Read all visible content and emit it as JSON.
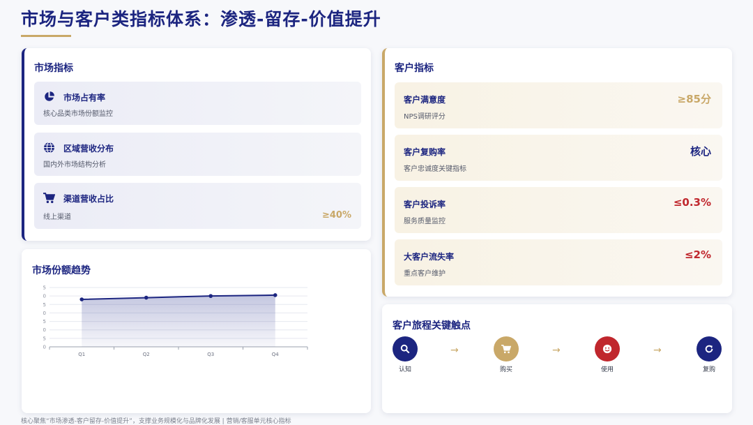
{
  "title": "市场与客户类指标体系：渗透-留存-价值提升",
  "colors": {
    "navy": "#1c2580",
    "gold": "#c9a868",
    "red": "#c0272d"
  },
  "market": {
    "heading": "市场指标",
    "items": [
      {
        "name": "市场占有率",
        "desc": "核心品类市场份额监控",
        "value": "",
        "icon": "pie-chart-icon"
      },
      {
        "name": "区域营收分布",
        "desc": "国内外市场结构分析",
        "value": "",
        "icon": "globe-icon"
      },
      {
        "name": "渠道营收占比",
        "desc": "线上渠道",
        "value": "≥40%",
        "icon": "cart-icon"
      }
    ]
  },
  "trend": {
    "heading": "市场份额趋势",
    "chart_data": {
      "type": "area",
      "categories": [
        "Q1",
        "Q2",
        "Q3",
        "Q4"
      ],
      "values": [
        28,
        29,
        30,
        30.5
      ],
      "ylim": [
        0,
        35
      ],
      "yticks": [
        "0",
        "5",
        "10",
        "15",
        "20",
        "25",
        "30",
        "35"
      ],
      "grid": true,
      "title": "",
      "xlabel": "",
      "ylabel": ""
    }
  },
  "customer": {
    "heading": "客户指标",
    "items": [
      {
        "name": "客户满意度",
        "desc": "NPS调研评分",
        "value": "≥85分",
        "color": "#c9a868"
      },
      {
        "name": "客户复购率",
        "desc": "客户忠诚度关键指标",
        "value": "核心",
        "color": "#1c2580"
      },
      {
        "name": "客户投诉率",
        "desc": "服务质量监控",
        "value": "≤0.3%",
        "color": "#c0272d"
      },
      {
        "name": "大客户流失率",
        "desc": "重点客户维护",
        "value": "≤2%",
        "color": "#c0272d"
      }
    ]
  },
  "journey": {
    "heading": "客户旅程关键触点",
    "steps": [
      {
        "label": "认知",
        "icon": "search-icon",
        "color": "#1c2580"
      },
      {
        "label": "购买",
        "icon": "cart-icon",
        "color": "#c9a868"
      },
      {
        "label": "使用",
        "icon": "smile-icon",
        "color": "#c0272d"
      },
      {
        "label": "复购",
        "icon": "refresh-icon",
        "color": "#1c2580"
      }
    ],
    "arrow": "→"
  },
  "footer": "核心聚焦“市场渗透-客户留存-价值提升”，支撑业务规模化与品牌化发展 | 营销/客服单元核心指标"
}
